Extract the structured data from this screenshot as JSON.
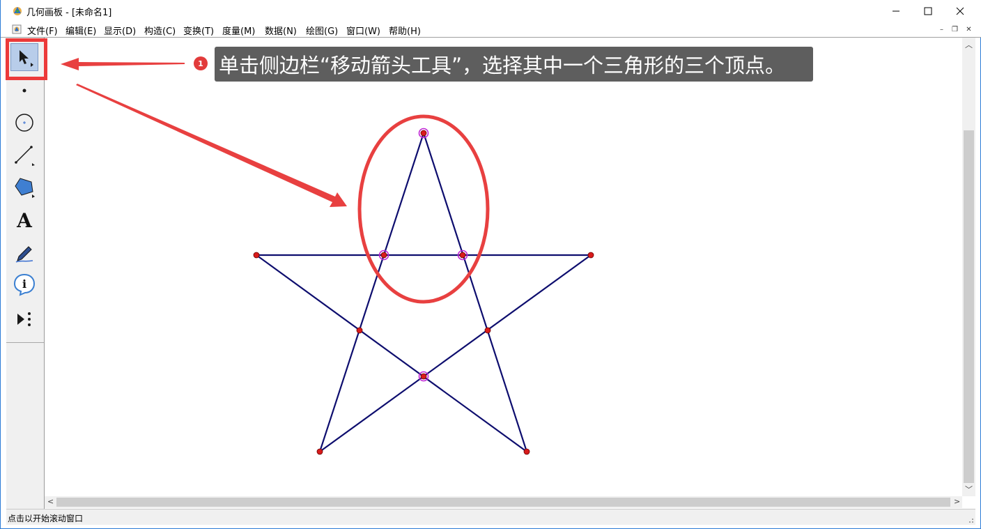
{
  "window": {
    "title": "几何画板 - [未命名1]",
    "minimize_glyph": "—",
    "maximize_glyph": "☐",
    "close_glyph": "✕"
  },
  "menu": {
    "items": [
      "文件(F)",
      "编辑(E)",
      "显示(D)",
      "构造(C)",
      "变换(T)",
      "度量(M)",
      "数据(N)",
      "绘图(G)",
      "窗口(W)",
      "帮助(H)"
    ],
    "mdi_minimize": "–",
    "mdi_restore": "❐",
    "mdi_close": "✕"
  },
  "toolbar": {
    "tools": [
      {
        "name": "arrow-tool",
        "icon": "select-arrow-icon",
        "active": true
      },
      {
        "name": "point-tool",
        "icon": "point-icon"
      },
      {
        "name": "compass-tool",
        "icon": "circle-icon"
      },
      {
        "name": "straightedge-tool",
        "icon": "segment-icon"
      },
      {
        "name": "polygon-tool",
        "icon": "polygon-icon"
      },
      {
        "name": "text-tool",
        "icon": "text-A-icon",
        "glyph": "A"
      },
      {
        "name": "marker-tool",
        "icon": "marker-pen-icon"
      },
      {
        "name": "information-tool",
        "icon": "info-icon",
        "glyph": "i"
      },
      {
        "name": "custom-tool",
        "icon": "custom-tools-icon"
      }
    ]
  },
  "annotation": {
    "step_number": "1",
    "text": "单击侧边栏“移动箭头工具”，选择其中一个三角形的三个顶点。"
  },
  "status": {
    "text": "点击以开始滚动窗口"
  },
  "colors": {
    "accent_red": "#e84040",
    "star_line": "#0d0d6e",
    "point_fill": "#d81b1b",
    "selection_ring": "#c026d3",
    "callout_bg": "#5e5e5e",
    "window_border": "#2b7bd6"
  }
}
